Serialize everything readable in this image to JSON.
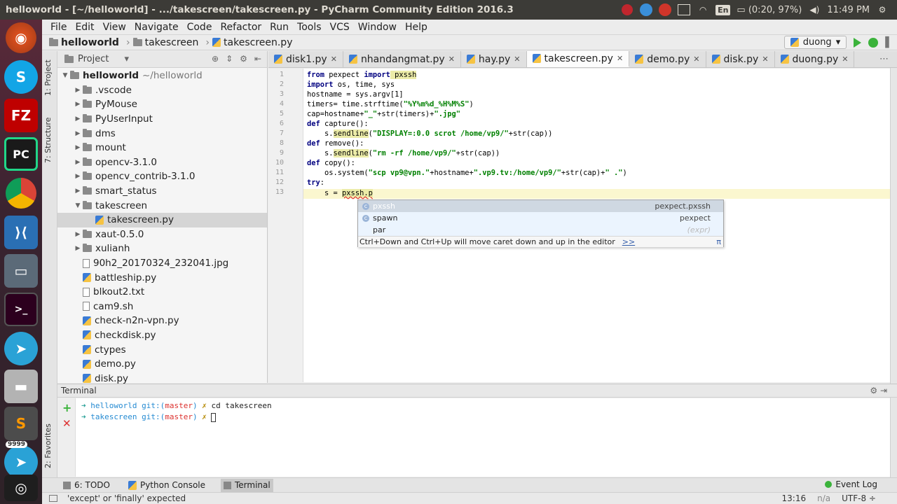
{
  "window_title": "helloworld - [~/helloworld] - .../takescreen/takescreen.py - PyCharm Community Edition 2016.3",
  "tray": {
    "battery": "(0:20, 97%)",
    "clock": "11:49 PM",
    "lang": "En"
  },
  "launcher": {
    "items": [
      "ubuntu-dash",
      "skype",
      "filezilla",
      "pycharm",
      "chrome",
      "vscode",
      "remote-desktop",
      "terminal",
      "telegram",
      "disks",
      "sublime-text",
      "telegram-9999",
      "workspace"
    ],
    "telegram_badge": "9999",
    "pycharm_label": "PC",
    "terminal_label": ">_",
    "sublime_label": "S",
    "filezilla_label": "FZ",
    "skype_label": "S"
  },
  "menu": [
    "File",
    "Edit",
    "View",
    "Navigate",
    "Code",
    "Refactor",
    "Run",
    "Tools",
    "VCS",
    "Window",
    "Help"
  ],
  "breadcrumb": {
    "root": "helloworld",
    "folder": "takescreen",
    "file": "takescreen.py"
  },
  "run_config": "duong",
  "left_strip": {
    "project": "1: Project",
    "structure": "7: Structure",
    "favorites": "2: Favorites"
  },
  "project": {
    "header": "Project",
    "root": "helloworld",
    "root_path": "~/helloworld",
    "items": [
      {
        "label": ".vscode",
        "kind": "folder"
      },
      {
        "label": "PyMouse",
        "kind": "folder"
      },
      {
        "label": "PyUserInput",
        "kind": "folder"
      },
      {
        "label": "dms",
        "kind": "folder"
      },
      {
        "label": "mount",
        "kind": "folder"
      },
      {
        "label": "opencv-3.1.0",
        "kind": "folder"
      },
      {
        "label": "opencv_contrib-3.1.0",
        "kind": "folder"
      },
      {
        "label": "smart_status",
        "kind": "folder"
      },
      {
        "label": "takescreen",
        "kind": "folder-open"
      },
      {
        "label": "takescreen.py",
        "kind": "py-child"
      },
      {
        "label": "xaut-0.5.0",
        "kind": "folder"
      },
      {
        "label": "xulianh",
        "kind": "folder"
      },
      {
        "label": "90h2_20170324_232041.jpg",
        "kind": "file"
      },
      {
        "label": "battleship.py",
        "kind": "py"
      },
      {
        "label": "blkout2.txt",
        "kind": "file"
      },
      {
        "label": "cam9.sh",
        "kind": "file"
      },
      {
        "label": "check-n2n-vpn.py",
        "kind": "py"
      },
      {
        "label": "checkdisk.py",
        "kind": "py"
      },
      {
        "label": "ctypes",
        "kind": "py"
      },
      {
        "label": "demo.py",
        "kind": "py"
      },
      {
        "label": "disk.py",
        "kind": "py"
      }
    ]
  },
  "tabs": [
    "disk1.py",
    "nhandangmat.py",
    "hay.py",
    "takescreen.py",
    "demo.py",
    "disk.py",
    "duong.py"
  ],
  "active_tab": "takescreen.py",
  "code": {
    "line_numbers": [
      "1",
      "2",
      "3",
      "4",
      "5",
      "6",
      "7",
      "8",
      "9",
      "10",
      "11",
      "12",
      "13"
    ],
    "l1_kw1": "from",
    "l1_mod": " pexpect ",
    "l1_kw2": "import",
    "l1_name": " pxssh",
    "l2_kw": "import",
    "l2_rest": " os, time, sys",
    "l3": "hostname = sys.argv[1]",
    "l4_a": "timers= time.strftime(",
    "l4_s": "\"%Y%m%d_%H%M%S\"",
    "l4_b": ")",
    "l5_a": "cap=hostname+",
    "l5_s1": "\"_\"",
    "l5_b": "+str(timers)+",
    "l5_s2": "\".jpg\"",
    "l6_kw": "def",
    "l6_rest": " capture():",
    "l7_a": "    s.",
    "l7_fn": "sendline",
    "l7_b": "(",
    "l7_s": "\"DISPLAY=:0.0 scrot /home/vp9/\"",
    "l7_c": "+str(cap))",
    "l8_kw": "def",
    "l8_rest": " remove():",
    "l9_a": "    s.",
    "l9_fn": "sendline",
    "l9_b": "(",
    "l9_s": "\"rm -rf /home/vp9/\"",
    "l9_c": "+str(cap))",
    "l10_kw": "def",
    "l10_rest": " copy():",
    "l11_a": "    os.system(",
    "l11_s1": "\"scp vp9@vpn.\"",
    "l11_b": "+hostname+",
    "l11_s2": "\".vp9.tv:/home/vp9/\"",
    "l11_c": "+str(cap)+",
    "l11_s3": "\" .\"",
    "l11_d": ")",
    "l12_kw": "try",
    "l12_rest": ":",
    "l13_a": "    s = ",
    "l13_b": "pxssh.p"
  },
  "completion": {
    "items": [
      {
        "name": "pxssh",
        "type": "c",
        "source": "pexpect.pxssh"
      },
      {
        "name": "spawn",
        "type": "c",
        "source": "pexpect"
      },
      {
        "name": "par",
        "type": "",
        "source": "(expr)"
      }
    ],
    "hint": "Ctrl+Down and Ctrl+Up will move caret down and up in the editor",
    "hint_link": ">>",
    "pin": "π"
  },
  "terminal": {
    "header": "Terminal",
    "lines": [
      {
        "arrow": "➜",
        "dir": "helloworld",
        "git": " git:(",
        "branch": "master",
        "git_end": ")",
        "mark": " ✗",
        "cmd": " cd takescreen"
      },
      {
        "arrow": "➜",
        "dir": "takescreen",
        "git": " git:(",
        "branch": "master",
        "git_end": ")",
        "mark": " ✗",
        "cmd": " "
      }
    ]
  },
  "bottom_tools": {
    "todo": "6: TODO",
    "python_console": "Python Console",
    "terminal": "Terminal",
    "event_log": "Event Log"
  },
  "status": {
    "message": "'except' or 'finally' expected",
    "position": "13:16",
    "line_sep": "n/a",
    "encoding": "UTF-8 ÷"
  }
}
